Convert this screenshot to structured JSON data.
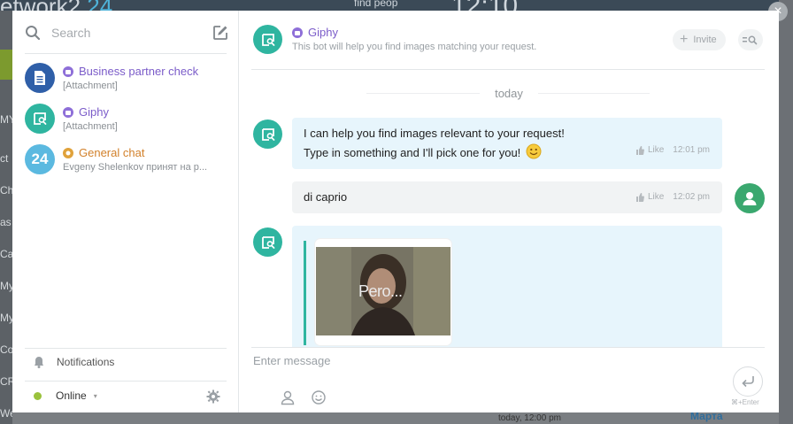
{
  "background": {
    "brand_text": "etwork2",
    "brand_num": "24",
    "find_people": "find peop",
    "clock": "12:10",
    "left_items": [
      "MY",
      "ct",
      "Cha",
      "as",
      "Cal",
      "My",
      "My",
      "Cor",
      "CR",
      "Webmail"
    ],
    "bottom_time": "today, 12:00 pm",
    "bottom_name": "Марта",
    "close_glyph": "×"
  },
  "sidebar": {
    "search_placeholder": "Search",
    "chats": [
      {
        "title": "Business partner check",
        "subtitle": "[Attachment]",
        "title_color": "#7b5cc9",
        "avatar_color": "#2f5fa8",
        "icon": "document-icon"
      },
      {
        "title": "Giphy",
        "subtitle": "[Attachment]",
        "title_color": "#7b5cc9",
        "avatar_color": "#2fb5a0",
        "icon": "giphy-bot-icon"
      },
      {
        "title": "General chat",
        "subtitle": "Evgeny Shelenkov принят на р...",
        "title_color": "#d2812b",
        "avatar_color": "#5bb9e0",
        "avatar_text": "24"
      }
    ],
    "notifications_label": "Notifications",
    "status_label": "Online",
    "status_caret": "▾"
  },
  "header": {
    "title": "Giphy",
    "subtitle": "This bot will help you find images matching your request.",
    "invite_label": "Invite",
    "invite_plus": "+"
  },
  "messages": {
    "day_label": "today",
    "items": [
      {
        "sender": "bot",
        "lines": [
          "I can help you find images relevant to your request!",
          "Type in something and I'll pick one for you!"
        ],
        "like_label": "Like",
        "time": "12:01 pm"
      },
      {
        "sender": "me",
        "lines": [
          "di caprio"
        ],
        "like_label": "Like",
        "time": "12:02 pm"
      },
      {
        "sender": "bot",
        "attachment_caption": "Pero..."
      }
    ]
  },
  "composer": {
    "placeholder": "Enter message",
    "send_hint": "⌘+Enter"
  },
  "colors": {
    "accent": "#2fb5a0",
    "bot_name": "#7b5cc9",
    "online": "#9ac23c"
  }
}
